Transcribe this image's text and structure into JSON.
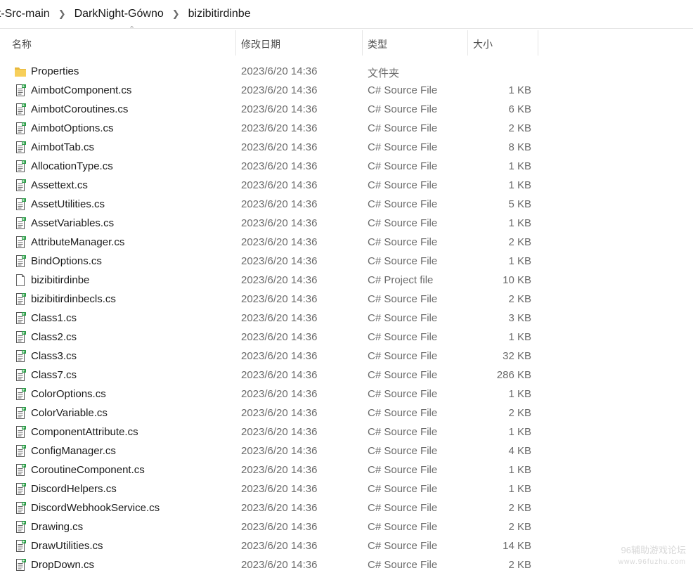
{
  "breadcrumb": [
    "ht-Src-main",
    "DarkNight-Gówno",
    "bizibitirdinbe"
  ],
  "columns": {
    "name": "名称",
    "date": "修改日期",
    "type": "类型",
    "size": "大小"
  },
  "rows": [
    {
      "name": "Properties",
      "date": "2023/6/20 14:36",
      "type": "文件夹",
      "size": "",
      "icon": "folder-icon"
    },
    {
      "name": "AimbotComponent.cs",
      "date": "2023/6/20 14:36",
      "type": "C# Source File",
      "size": "1 KB",
      "icon": "cs-file-icon"
    },
    {
      "name": "AimbotCoroutines.cs",
      "date": "2023/6/20 14:36",
      "type": "C# Source File",
      "size": "6 KB",
      "icon": "cs-file-icon"
    },
    {
      "name": "AimbotOptions.cs",
      "date": "2023/6/20 14:36",
      "type": "C# Source File",
      "size": "2 KB",
      "icon": "cs-file-icon"
    },
    {
      "name": "AimbotTab.cs",
      "date": "2023/6/20 14:36",
      "type": "C# Source File",
      "size": "8 KB",
      "icon": "cs-file-icon"
    },
    {
      "name": "AllocationType.cs",
      "date": "2023/6/20 14:36",
      "type": "C# Source File",
      "size": "1 KB",
      "icon": "cs-file-icon"
    },
    {
      "name": "Assettext.cs",
      "date": "2023/6/20 14:36",
      "type": "C# Source File",
      "size": "1 KB",
      "icon": "cs-file-icon"
    },
    {
      "name": "AssetUtilities.cs",
      "date": "2023/6/20 14:36",
      "type": "C# Source File",
      "size": "5 KB",
      "icon": "cs-file-icon"
    },
    {
      "name": "AssetVariables.cs",
      "date": "2023/6/20 14:36",
      "type": "C# Source File",
      "size": "1 KB",
      "icon": "cs-file-icon"
    },
    {
      "name": "AttributeManager.cs",
      "date": "2023/6/20 14:36",
      "type": "C# Source File",
      "size": "2 KB",
      "icon": "cs-file-icon"
    },
    {
      "name": "BindOptions.cs",
      "date": "2023/6/20 14:36",
      "type": "C# Source File",
      "size": "1 KB",
      "icon": "cs-file-icon"
    },
    {
      "name": "bizibitirdinbe",
      "date": "2023/6/20 14:36",
      "type": "C# Project file",
      "size": "10 KB",
      "icon": "blank-file-icon"
    },
    {
      "name": "bizibitirdinbecls.cs",
      "date": "2023/6/20 14:36",
      "type": "C# Source File",
      "size": "2 KB",
      "icon": "cs-file-icon"
    },
    {
      "name": "Class1.cs",
      "date": "2023/6/20 14:36",
      "type": "C# Source File",
      "size": "3 KB",
      "icon": "cs-file-icon"
    },
    {
      "name": "Class2.cs",
      "date": "2023/6/20 14:36",
      "type": "C# Source File",
      "size": "1 KB",
      "icon": "cs-file-icon"
    },
    {
      "name": "Class3.cs",
      "date": "2023/6/20 14:36",
      "type": "C# Source File",
      "size": "32 KB",
      "icon": "cs-file-icon"
    },
    {
      "name": "Class7.cs",
      "date": "2023/6/20 14:36",
      "type": "C# Source File",
      "size": "286 KB",
      "icon": "cs-file-icon"
    },
    {
      "name": "ColorOptions.cs",
      "date": "2023/6/20 14:36",
      "type": "C# Source File",
      "size": "1 KB",
      "icon": "cs-file-icon"
    },
    {
      "name": "ColorVariable.cs",
      "date": "2023/6/20 14:36",
      "type": "C# Source File",
      "size": "2 KB",
      "icon": "cs-file-icon"
    },
    {
      "name": "ComponentAttribute.cs",
      "date": "2023/6/20 14:36",
      "type": "C# Source File",
      "size": "1 KB",
      "icon": "cs-file-icon"
    },
    {
      "name": "ConfigManager.cs",
      "date": "2023/6/20 14:36",
      "type": "C# Source File",
      "size": "4 KB",
      "icon": "cs-file-icon"
    },
    {
      "name": "CoroutineComponent.cs",
      "date": "2023/6/20 14:36",
      "type": "C# Source File",
      "size": "1 KB",
      "icon": "cs-file-icon"
    },
    {
      "name": "DiscordHelpers.cs",
      "date": "2023/6/20 14:36",
      "type": "C# Source File",
      "size": "1 KB",
      "icon": "cs-file-icon"
    },
    {
      "name": "DiscordWebhookService.cs",
      "date": "2023/6/20 14:36",
      "type": "C# Source File",
      "size": "2 KB",
      "icon": "cs-file-icon"
    },
    {
      "name": "Drawing.cs",
      "date": "2023/6/20 14:36",
      "type": "C# Source File",
      "size": "2 KB",
      "icon": "cs-file-icon"
    },
    {
      "name": "DrawUtilities.cs",
      "date": "2023/6/20 14:36",
      "type": "C# Source File",
      "size": "14 KB",
      "icon": "cs-file-icon"
    },
    {
      "name": "DropDown.cs",
      "date": "2023/6/20 14:36",
      "type": "C# Source File",
      "size": "2 KB",
      "icon": "cs-file-icon"
    }
  ],
  "watermark": {
    "line1": "96辅助游戏论坛",
    "line2": "www.96fuzhu.com"
  }
}
